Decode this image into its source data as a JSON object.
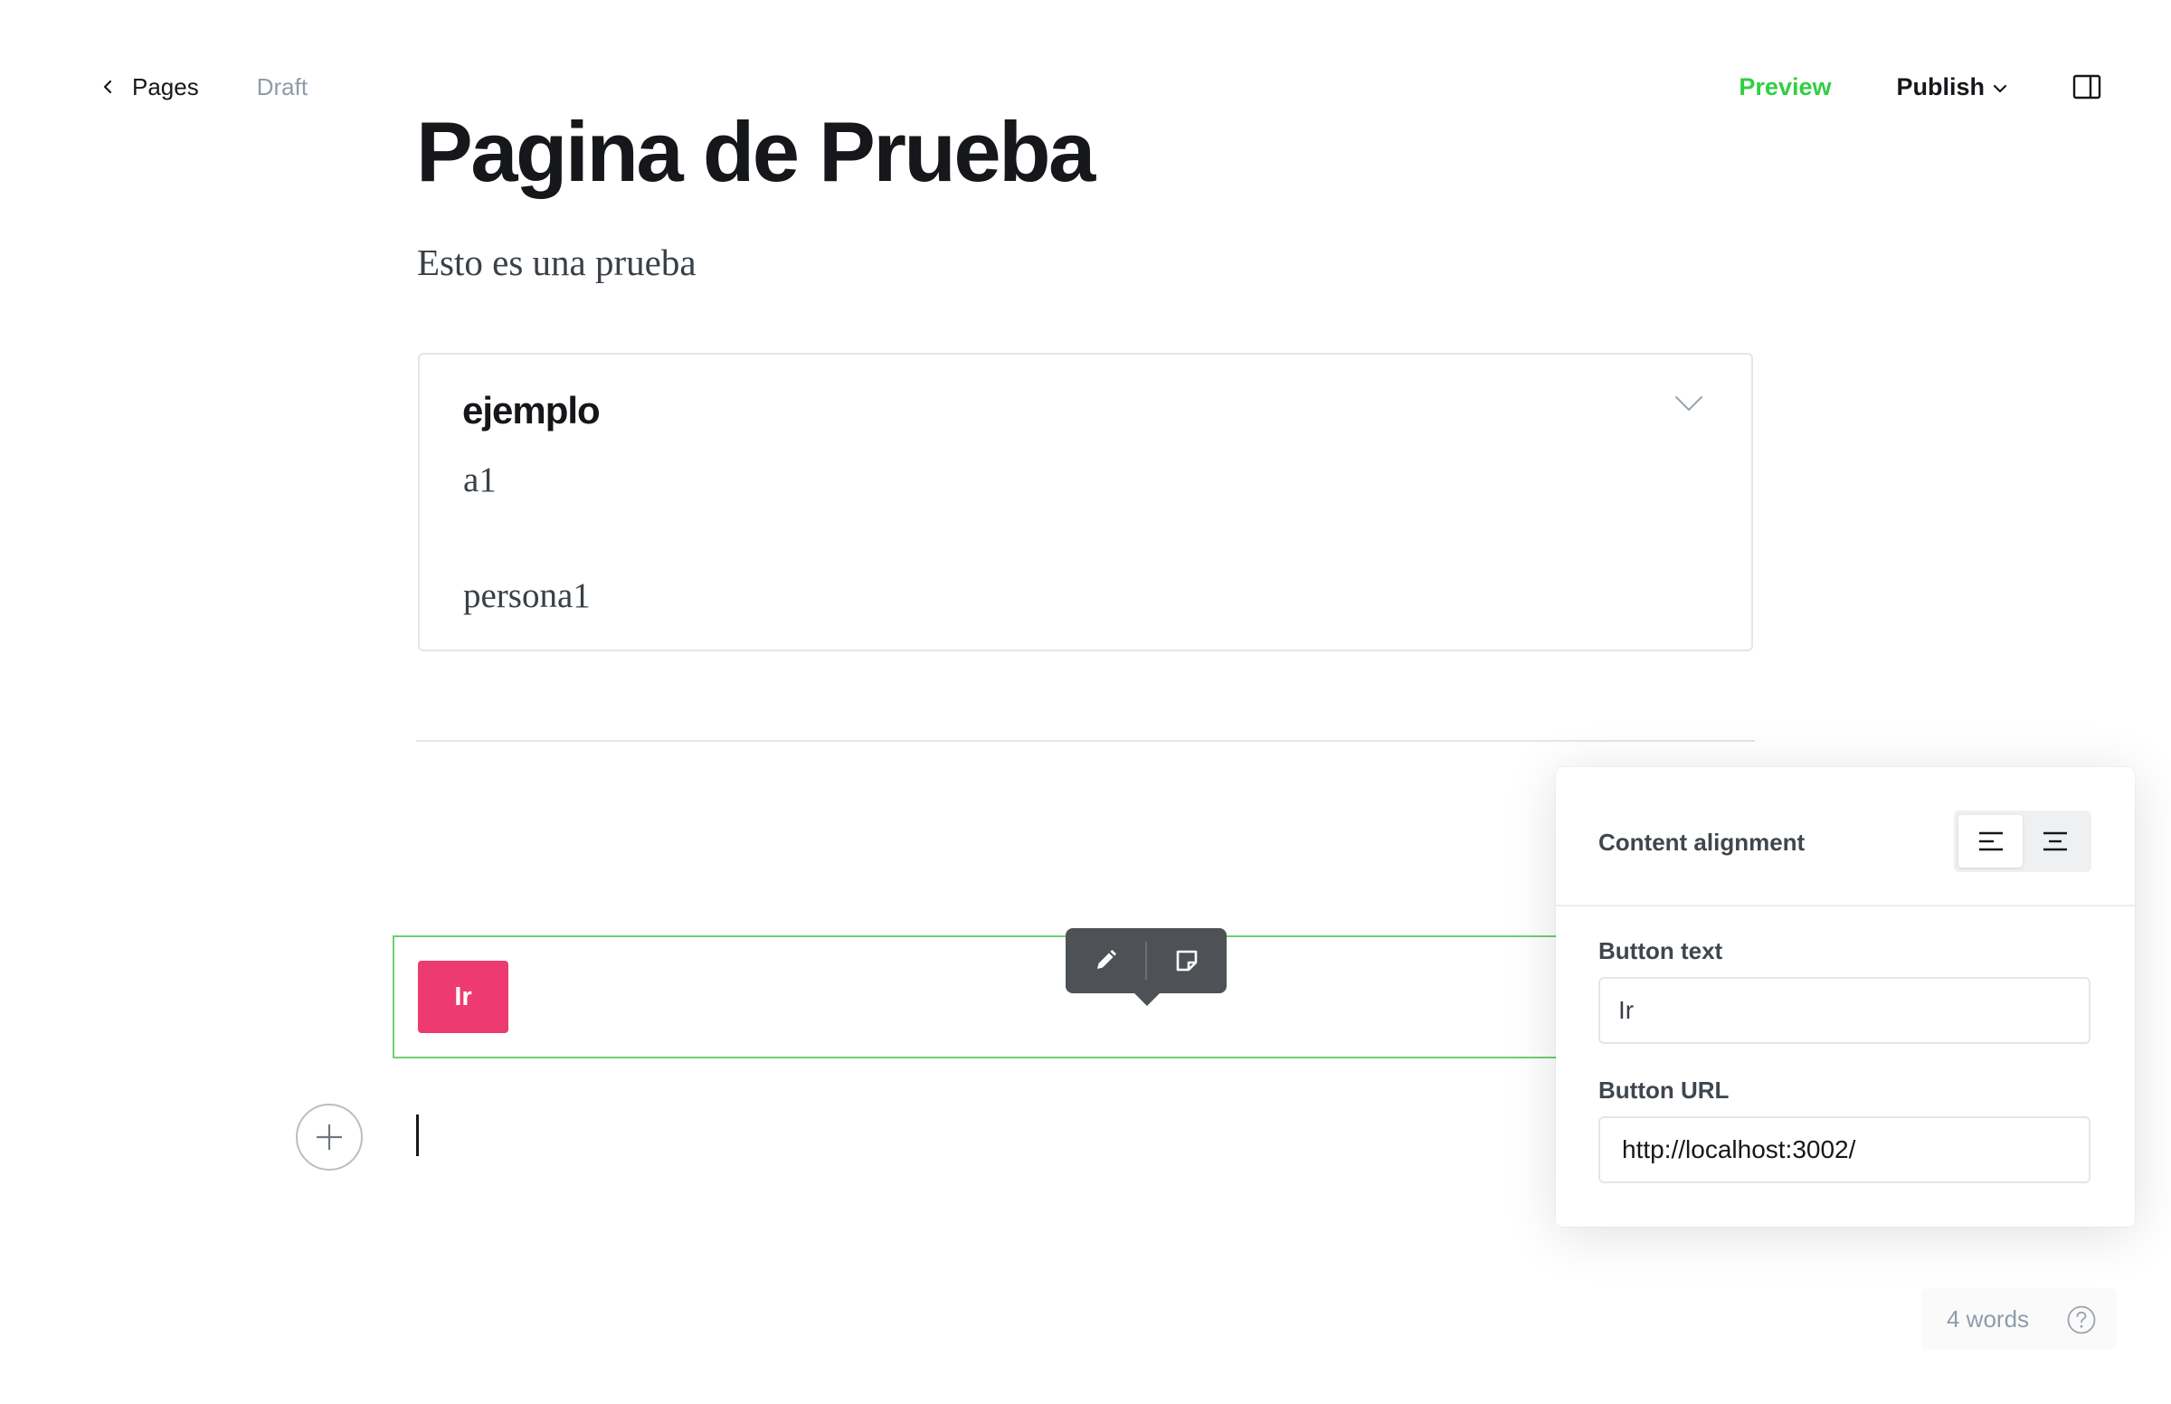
{
  "topbar": {
    "back_label": "Pages",
    "status_label": "Draft",
    "preview_label": "Preview",
    "publish_label": "Publish",
    "icons": {
      "back": "chevron-left-icon",
      "publish_menu": "chevron-down-icon",
      "sidebar": "sidebar-panel-icon"
    }
  },
  "post": {
    "title": "Pagina de Prueba",
    "excerpt": "Esto es una prueba"
  },
  "toggle_card": {
    "heading": "ejemplo",
    "lines": [
      "a1",
      "persona1"
    ],
    "icon": "chevron-down-icon"
  },
  "button_card": {
    "button_text": "Ir",
    "button_color": "#ed3a71",
    "toolbar_icons": [
      "pencil-icon",
      "snippet-icon"
    ]
  },
  "settings_panel": {
    "alignment_label": "Content alignment",
    "alignment_options": [
      "left",
      "center"
    ],
    "alignment_selected": "left",
    "button_text_label": "Button text",
    "button_text_value": "Ir",
    "button_url_label": "Button URL",
    "button_url_value": "http://localhost:3002/"
  },
  "footer": {
    "word_count": "4 words",
    "help_icon": "question-circle-icon"
  },
  "colors": {
    "accent_green": "#30cf43",
    "selection_border": "#6fcf76",
    "toolbar_bg": "#4e5257"
  }
}
